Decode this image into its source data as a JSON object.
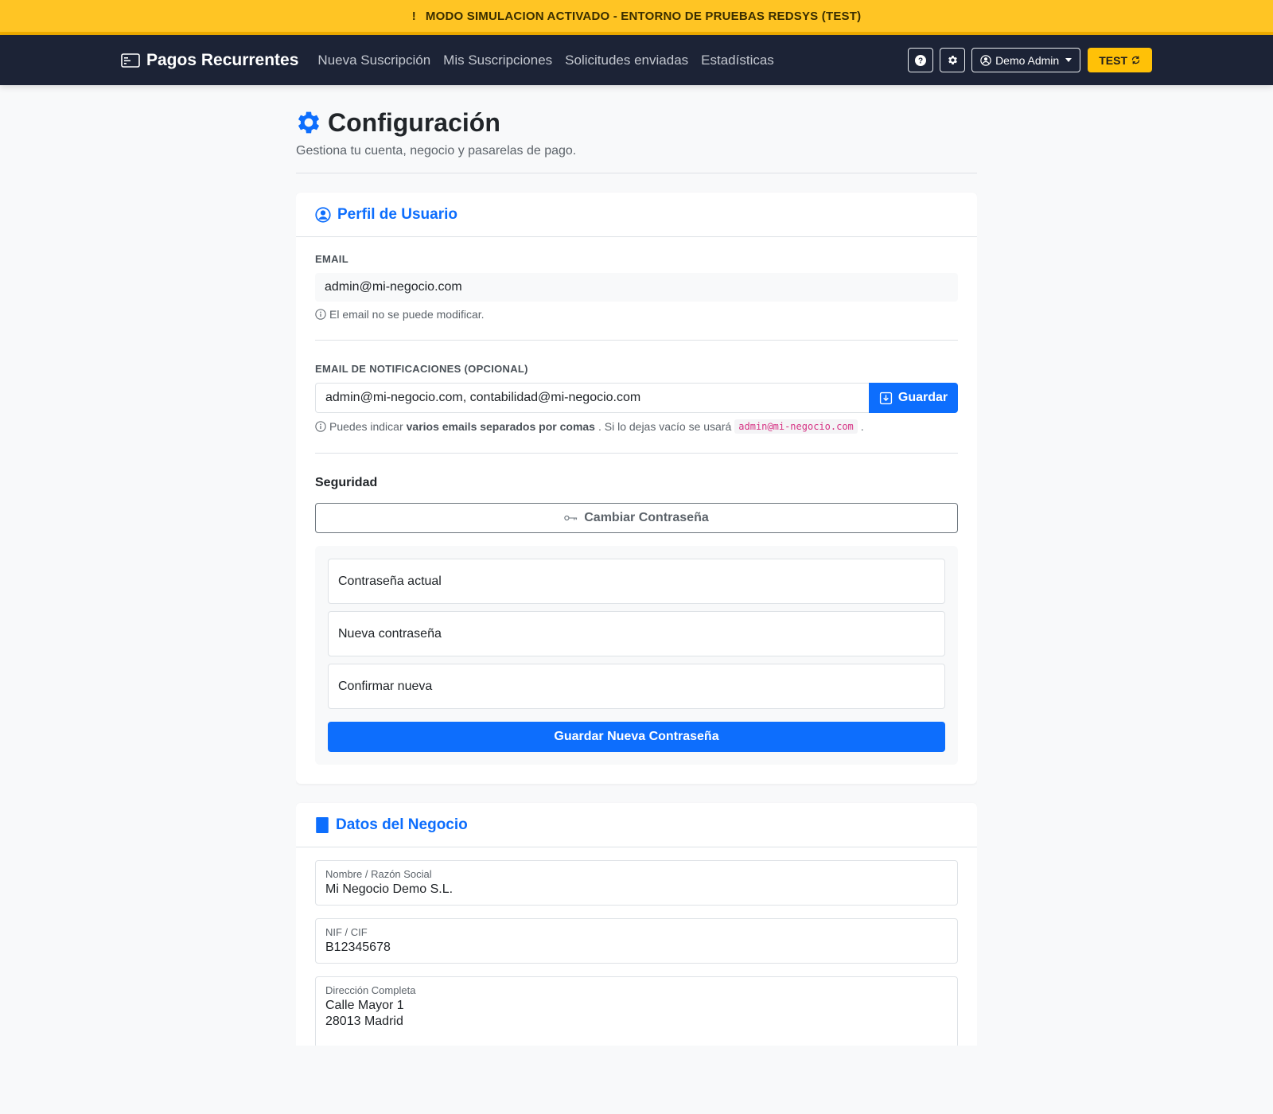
{
  "banner": {
    "text": "MODO SIMULACION ACTIVADO - ENTORNO DE PRUEBAS REDSYS (TEST)"
  },
  "navbar": {
    "brand": "Pagos Recurrentes",
    "links": [
      "Nueva Suscripción",
      "Mis Suscripciones",
      "Solicitudes enviadas",
      "Estadísticas"
    ],
    "user": "Demo Admin",
    "mode": "TEST"
  },
  "page": {
    "title": "Configuración",
    "subtitle": "Gestiona tu cuenta, negocio y pasarelas de pago."
  },
  "profile": {
    "title": "Perfil de Usuario",
    "email_label": "EMAIL",
    "email_value": "admin@mi-negocio.com",
    "email_help": "El email no se puede modificar.",
    "notif_label": "EMAIL DE NOTIFICACIONES (OPCIONAL)",
    "notif_value": "admin@mi-negocio.com, contabilidad@mi-negocio.com",
    "save_label": "Guardar",
    "notif_help_1": "Puedes indicar",
    "notif_help_bold": "varios emails separados por comas",
    "notif_help_2": ". Si lo dejas vacío se usará",
    "notif_help_code": "admin@mi-negocio.com",
    "notif_help_3": ".",
    "security_title": "Seguridad",
    "change_pw_label": "Cambiar Contraseña",
    "current_pw": "Contraseña actual",
    "new_pw": "Nueva contraseña",
    "confirm_pw": "Confirmar nueva",
    "save_pw_label": "Guardar Nueva Contraseña"
  },
  "business": {
    "title": "Datos del Negocio",
    "name_label": "Nombre / Razón Social",
    "name_value": "Mi Negocio Demo S.L.",
    "nif_label": "NIF / CIF",
    "nif_value": "B12345678",
    "address_label": "Dirección Completa",
    "address_line1": "Calle Mayor 1",
    "address_line2": "28013 Madrid"
  },
  "colors": {
    "banner": "#ffc524",
    "navbar": "#1c2336",
    "primary": "#0d6efd",
    "test_badge": "#ffc107"
  }
}
